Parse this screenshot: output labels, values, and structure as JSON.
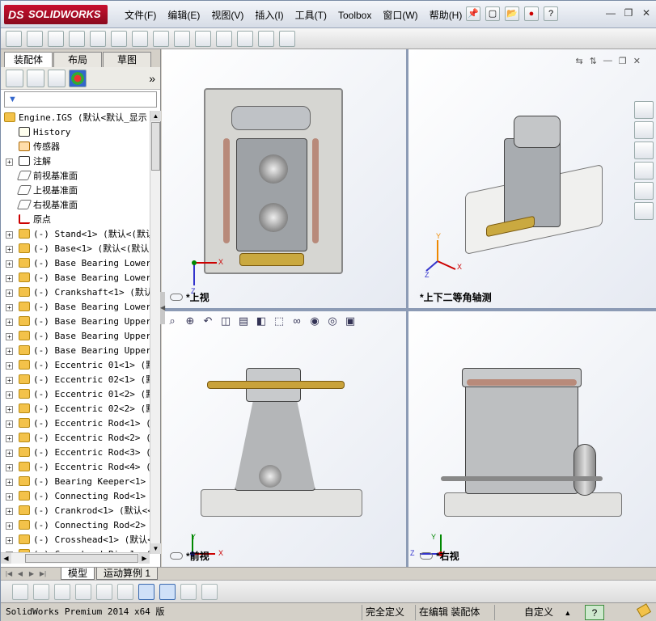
{
  "app": {
    "name": "SOLIDWORKS",
    "ds_mark": "DS"
  },
  "menu": [
    "文件(F)",
    "编辑(E)",
    "视图(V)",
    "插入(I)",
    "工具(T)",
    "Toolbox",
    "窗口(W)",
    "帮助(H)"
  ],
  "title_tools": {
    "pin": "📌",
    "new": "▢",
    "open": "📂",
    "traffic": "●",
    "help": "?"
  },
  "window_buttons": {
    "minimize": "—",
    "restore": "❐",
    "close": "✕"
  },
  "feature_manager": {
    "tabs": [
      "装配体",
      "布局",
      "草图"
    ],
    "more": "»",
    "filter_icon": "▼",
    "root": "Engine.IGS  (默认<默认_显示",
    "items": [
      {
        "label": "History",
        "icon": "history-icon",
        "expand": false
      },
      {
        "label": "传感器",
        "icon": "sensor-icon",
        "expand": false
      },
      {
        "label": "注解",
        "icon": "annotation-icon",
        "expand": true
      },
      {
        "label": "前视基准面",
        "icon": "plane-icon",
        "expand": false
      },
      {
        "label": "上视基准面",
        "icon": "plane-icon",
        "expand": false
      },
      {
        "label": "右视基准面",
        "icon": "plane-icon",
        "expand": false
      },
      {
        "label": "原点",
        "icon": "origin-icon",
        "expand": false
      },
      {
        "label": "(-) Stand<1> (默认<(默认",
        "icon": "part-icon",
        "expand": true
      },
      {
        "label": "(-) Base<1> (默认<(默认",
        "icon": "part-icon",
        "expand": true
      },
      {
        "label": "(-) Base Bearing Lower",
        "icon": "part-icon",
        "expand": true
      },
      {
        "label": "(-) Base Bearing Lower",
        "icon": "part-icon",
        "expand": true
      },
      {
        "label": "(-) Crankshaft<1> (默认",
        "icon": "part-icon",
        "expand": true
      },
      {
        "label": "(-) Base Bearing Lower",
        "icon": "part-icon",
        "expand": true
      },
      {
        "label": "(-) Base Bearing Upper",
        "icon": "part-icon",
        "expand": true
      },
      {
        "label": "(-) Base Bearing Upper",
        "icon": "part-icon",
        "expand": true
      },
      {
        "label": "(-) Base Bearing Upper",
        "icon": "part-icon",
        "expand": true
      },
      {
        "label": "(-) Eccentric 01<1> (默",
        "icon": "part-icon",
        "expand": true
      },
      {
        "label": "(-) Eccentric 02<1> (默",
        "icon": "part-icon",
        "expand": true
      },
      {
        "label": "(-) Eccentric 01<2> (默",
        "icon": "part-icon",
        "expand": true
      },
      {
        "label": "(-) Eccentric 02<2> (默",
        "icon": "part-icon",
        "expand": true
      },
      {
        "label": "(-) Eccentric Rod<1> (默",
        "icon": "part-icon",
        "expand": true
      },
      {
        "label": "(-) Eccentric Rod<2> (默",
        "icon": "part-icon",
        "expand": true
      },
      {
        "label": "(-) Eccentric Rod<3> (默",
        "icon": "part-icon",
        "expand": true
      },
      {
        "label": "(-) Eccentric Rod<4> (默",
        "icon": "part-icon",
        "expand": true
      },
      {
        "label": "(-) Bearing Keeper<1> (",
        "icon": "part-icon",
        "expand": true
      },
      {
        "label": "(-) Connecting Rod<1> (",
        "icon": "part-icon",
        "expand": true
      },
      {
        "label": "(-) Crankrod<1> (默认<<",
        "icon": "part-icon",
        "expand": true
      },
      {
        "label": "(-) Connecting Rod<2> (",
        "icon": "part-icon",
        "expand": true
      },
      {
        "label": "(-) Crosshead<1> (默认<",
        "icon": "part-icon",
        "expand": true
      },
      {
        "label": "(-) Crosshead Pin<1> (默",
        "icon": "part-icon",
        "expand": true
      }
    ]
  },
  "viewports": {
    "top_left": "*上视",
    "top_right": "*上下二等角轴测",
    "bottom_left": "*前视",
    "bottom_right": "*右视"
  },
  "axes": {
    "x": "X",
    "y": "Y",
    "z": "Z"
  },
  "bottom_tabs": [
    "模型",
    "运动算例 1"
  ],
  "status": {
    "app_version": "SolidWorks Premium 2014 x64 版",
    "definition": "完全定义",
    "editing": "在编辑 装配体",
    "units": "自定义",
    "help": "?"
  },
  "colors": {
    "accent": "#c8102e",
    "separator": "#8c9bb5",
    "part_icon": "#f3c24a"
  }
}
